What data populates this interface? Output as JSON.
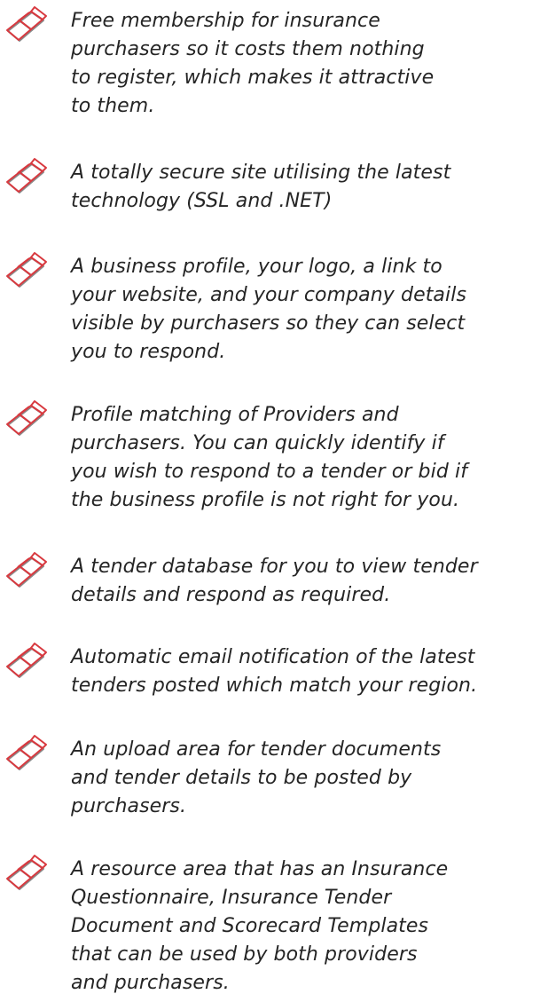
{
  "features": [
    {
      "icon": "red-diamond-bullet-icon",
      "text": "Free membership for insurance\npurchasers so it costs them nothing\nto register, which makes it attractive\nto them."
    },
    {
      "icon": "red-diamond-bullet-icon",
      "text": "A totally secure site utilising the latest\ntechnology (SSL and .NET)"
    },
    {
      "icon": "red-diamond-bullet-icon",
      "text": "A business profile, your logo, a link to\nyour website, and your company details\nvisible by purchasers so they can select\nyou to respond."
    },
    {
      "icon": "red-diamond-bullet-icon",
      "text": "Profile matching of Providers and\npurchasers. You can quickly identify if\nyou  wish to respond to a tender or bid if\nthe business profile is not right for you."
    },
    {
      "icon": "red-diamond-bullet-icon",
      "text": "A tender database for you to view tender\ndetails and respond as required."
    },
    {
      "icon": "red-diamond-bullet-icon",
      "text": "Automatic email notification of the latest\ntenders posted which match your region."
    },
    {
      "icon": "red-diamond-bullet-icon",
      "text": "An upload area for tender documents\nand tender details to be posted by\npurchasers."
    },
    {
      "icon": "red-diamond-bullet-icon",
      "text": "A resource area that has an Insurance\nQuestionnaire, Insurance Tender\nDocument and Scorecard Templates\nthat can be used by both providers\nand  purchasers."
    }
  ],
  "colors": {
    "text": "#252525",
    "bullet_red": "#d8393f",
    "bullet_shadow": "#8a8a8a"
  }
}
